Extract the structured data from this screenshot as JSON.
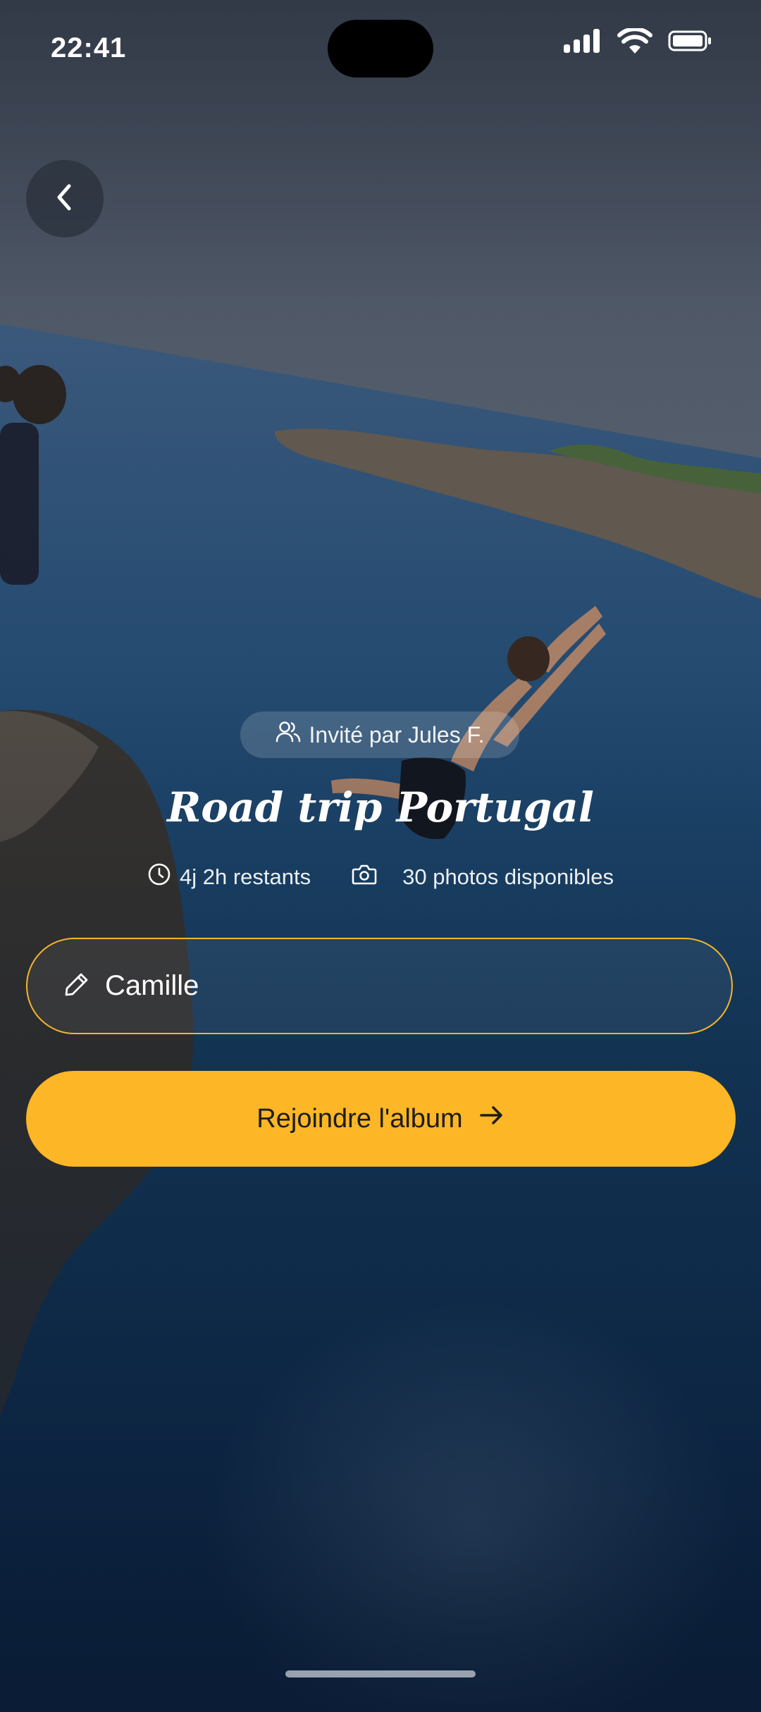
{
  "status_bar": {
    "time": "22:41",
    "icons": [
      "cellular-signal-icon",
      "wifi-icon",
      "battery-icon"
    ]
  },
  "header": {
    "back_icon": "chevron-left-icon"
  },
  "album": {
    "invite_text": "Invité par Jules F.",
    "title": "Road trip Portugal",
    "time_remaining": "4j 2h restants",
    "photos_available": "30 photos disponibles"
  },
  "form": {
    "name_value": "Camille",
    "join_label": "Rejoindre l'album"
  },
  "colors": {
    "accent": "#FDB625",
    "field_border": "#F6B62A",
    "text": "#FFFFFF",
    "button_text": "#1D1D1F"
  }
}
